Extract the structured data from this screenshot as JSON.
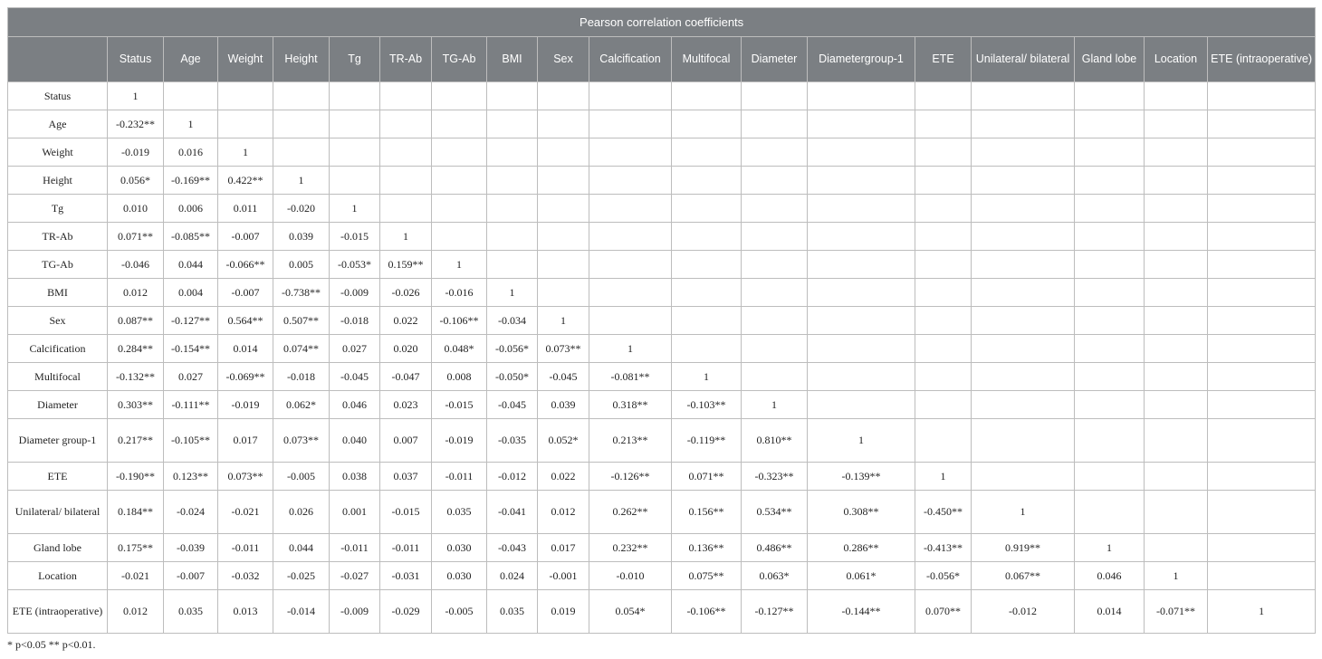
{
  "table": {
    "title": "Pearson correlation coefficients",
    "columns": [
      "Status",
      "Age",
      "Weight",
      "Height",
      "Tg",
      "TR-Ab",
      "TG-Ab",
      "BMI",
      "Sex",
      "Calcification",
      "Multifocal",
      "Diameter",
      "Diametergroup-1",
      "ETE",
      "Unilateral/ bilateral",
      "Gland lobe",
      "Location",
      "ETE (intraoperative)"
    ],
    "rows": [
      {
        "label": "Status",
        "cells": [
          "1"
        ]
      },
      {
        "label": "Age",
        "cells": [
          "-0.232**",
          "1"
        ]
      },
      {
        "label": "Weight",
        "cells": [
          "-0.019",
          "0.016",
          "1"
        ]
      },
      {
        "label": "Height",
        "cells": [
          "0.056*",
          "-0.169**",
          "0.422**",
          "1"
        ]
      },
      {
        "label": "Tg",
        "cells": [
          "0.010",
          "0.006",
          "0.011",
          "-0.020",
          "1"
        ]
      },
      {
        "label": "TR-Ab",
        "cells": [
          "0.071**",
          "-0.085**",
          "-0.007",
          "0.039",
          "-0.015",
          "1"
        ]
      },
      {
        "label": "TG-Ab",
        "cells": [
          "-0.046",
          "0.044",
          "-0.066**",
          "0.005",
          "-0.053*",
          "0.159**",
          "1"
        ]
      },
      {
        "label": "BMI",
        "cells": [
          "0.012",
          "0.004",
          "-0.007",
          "-0.738**",
          "-0.009",
          "-0.026",
          "-0.016",
          "1"
        ]
      },
      {
        "label": "Sex",
        "cells": [
          "0.087**",
          "-0.127**",
          "0.564**",
          "0.507**",
          "-0.018",
          "0.022",
          "-0.106**",
          "-0.034",
          "1"
        ]
      },
      {
        "label": "Calcification",
        "cells": [
          "0.284**",
          "-0.154**",
          "0.014",
          "0.074**",
          "0.027",
          "0.020",
          "0.048*",
          "-0.056*",
          "0.073**",
          "1"
        ]
      },
      {
        "label": "Multifocal",
        "cells": [
          "-0.132**",
          "0.027",
          "-0.069**",
          "-0.018",
          "-0.045",
          "-0.047",
          "0.008",
          "-0.050*",
          "-0.045",
          "-0.081**",
          "1"
        ]
      },
      {
        "label": "Diameter",
        "cells": [
          "0.303**",
          "-0.111**",
          "-0.019",
          "0.062*",
          "0.046",
          "0.023",
          "-0.015",
          "-0.045",
          "0.039",
          "0.318**",
          "-0.103**",
          "1"
        ]
      },
      {
        "label": "Diameter group-1",
        "tall": true,
        "cells": [
          "0.217**",
          "-0.105**",
          "0.017",
          "0.073**",
          "0.040",
          "0.007",
          "-0.019",
          "-0.035",
          "0.052*",
          "0.213**",
          "-0.119**",
          "0.810**",
          "1"
        ]
      },
      {
        "label": "ETE",
        "cells": [
          "-0.190**",
          "0.123**",
          "0.073**",
          "-0.005",
          "0.038",
          "0.037",
          "-0.011",
          "-0.012",
          "0.022",
          "-0.126**",
          "0.071**",
          "-0.323**",
          "-0.139**",
          "1"
        ]
      },
      {
        "label": "Unilateral/ bilateral",
        "tall": true,
        "cells": [
          "0.184**",
          "-0.024",
          "-0.021",
          "0.026",
          "0.001",
          "-0.015",
          "0.035",
          "-0.041",
          "0.012",
          "0.262**",
          "0.156**",
          "0.534**",
          "0.308**",
          "-0.450**",
          "1"
        ]
      },
      {
        "label": "Gland lobe",
        "cells": [
          "0.175**",
          "-0.039",
          "-0.011",
          "0.044",
          "-0.011",
          "-0.011",
          "0.030",
          "-0.043",
          "0.017",
          "0.232**",
          "0.136**",
          "0.486**",
          "0.286**",
          "-0.413**",
          "0.919**",
          "1"
        ]
      },
      {
        "label": "Location",
        "cells": [
          "-0.021",
          "-0.007",
          "-0.032",
          "-0.025",
          "-0.027",
          "-0.031",
          "0.030",
          "0.024",
          "-0.001",
          "-0.010",
          "0.075**",
          "0.063*",
          "0.061*",
          "-0.056*",
          "0.067**",
          "0.046",
          "1"
        ]
      },
      {
        "label": "ETE (intraoperative)",
        "tall": true,
        "cells": [
          "0.012",
          "0.035",
          "0.013",
          "-0.014",
          "-0.009",
          "-0.029",
          "-0.005",
          "0.035",
          "0.019",
          "0.054*",
          "-0.106**",
          "-0.127**",
          "-0.144**",
          "0.070**",
          "-0.012",
          "0.014",
          "-0.071**",
          "1"
        ]
      }
    ],
    "footnote": "* p<0.05 ** p<0.01."
  },
  "colors": {
    "header_bg": "#7b7f83",
    "header_text": "#ffffff",
    "border": "#bdbdbd"
  }
}
